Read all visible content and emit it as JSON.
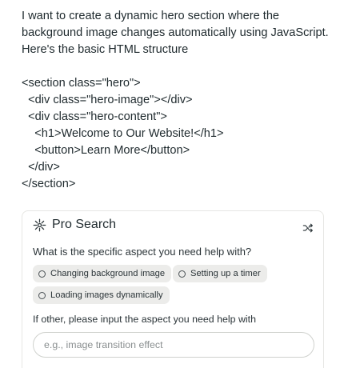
{
  "message": {
    "intro": "I want to create a dynamic hero section where the background image changes automatically using JavaScript. Here's the basic HTML structure",
    "code_lines": [
      "<section class=\"hero\">",
      "  <div class=\"hero-image\"></div>",
      "  <div class=\"hero-content\">",
      "    <h1>Welcome to Our Website!</h1>",
      "    <button>Learn More</button>",
      "  </div>",
      "</section>"
    ]
  },
  "pro_search": {
    "title": "Pro Search",
    "title_icon": "sparkle-icon",
    "shuffle_icon": "shuffle-icon",
    "question": "What is the specific aspect you need help with?",
    "options": [
      "Changing background image",
      "Setting up a timer",
      "Loading images dynamically"
    ],
    "other_label": "If other, please input the aspect you need help with",
    "input_value": "",
    "input_placeholder": "e.g., image transition effect"
  }
}
